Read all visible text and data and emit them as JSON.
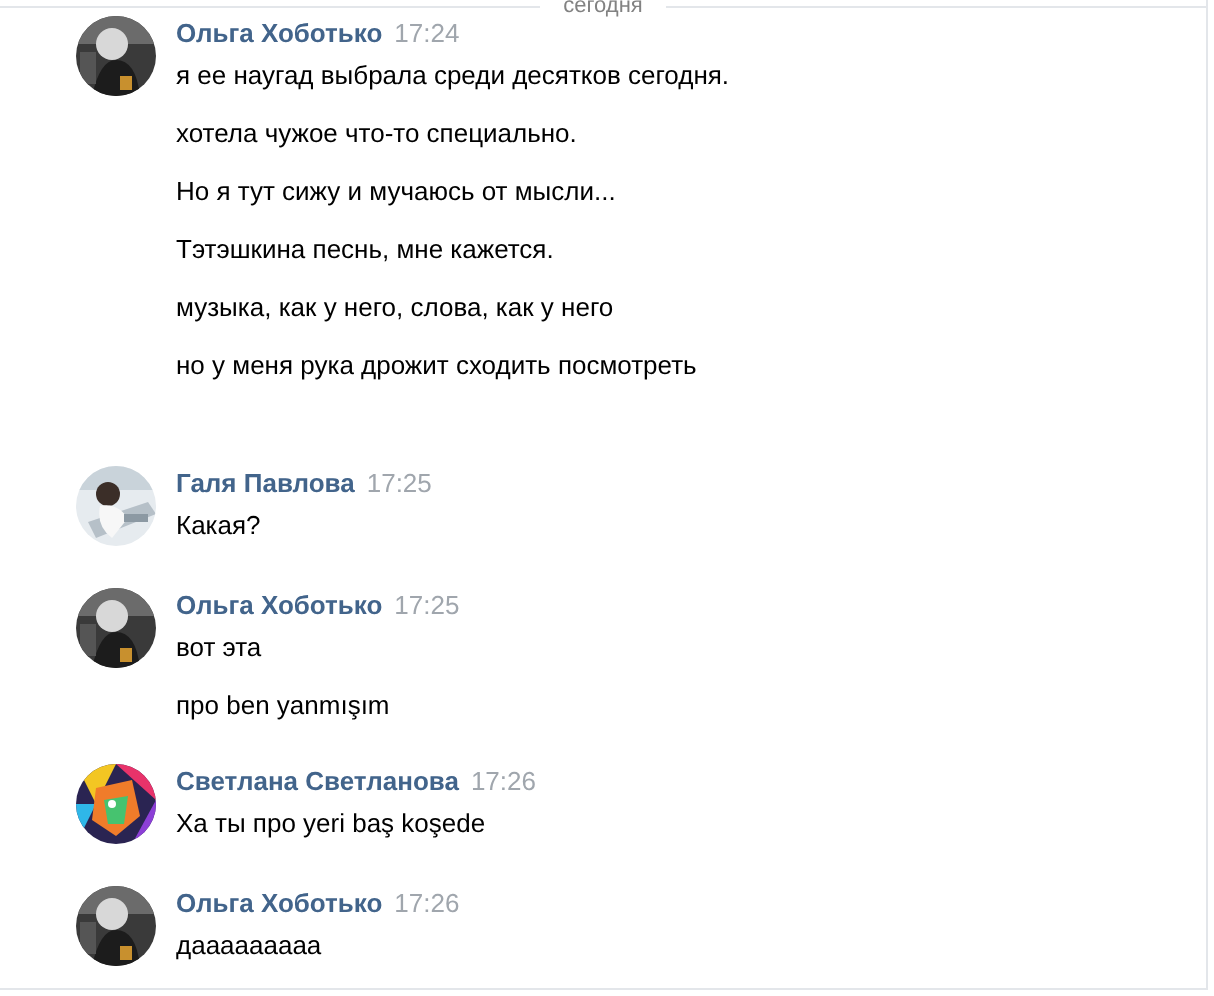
{
  "date_divider": "сегодня",
  "messages": [
    {
      "author": "Ольга Хоботько",
      "time": "17:24",
      "avatar": {
        "kind": "picture"
      },
      "lines": [
        "я ее наугад выбрала среди десятков сегодня.",
        "хотела чужое что-то специально.",
        "Но я тут сижу и мучаюсь от мысли...",
        "Тэтэшкина песнь, мне кажется.",
        "музыка, как у него, слова, как у него",
        "но у меня рука дрожит сходить посмотреть"
      ]
    },
    {
      "author": "Галя Павлова",
      "time": "17:25",
      "avatar": {
        "kind": "picture"
      },
      "lines": [
        "Какая?"
      ]
    },
    {
      "author": "Ольга Хоботько",
      "time": "17:25",
      "avatar": {
        "kind": "picture"
      },
      "lines": [
        "вот эта",
        "про ben yanmışım"
      ]
    },
    {
      "author": "Светлана Светланова",
      "time": "17:26",
      "avatar": {
        "kind": "picture"
      },
      "lines": [
        "Ха ты про yeri baş koşede"
      ]
    },
    {
      "author": "Ольга Хоботько",
      "time": "17:26",
      "avatar": {
        "kind": "picture"
      },
      "lines": [
        "дааааааааа"
      ]
    }
  ]
}
